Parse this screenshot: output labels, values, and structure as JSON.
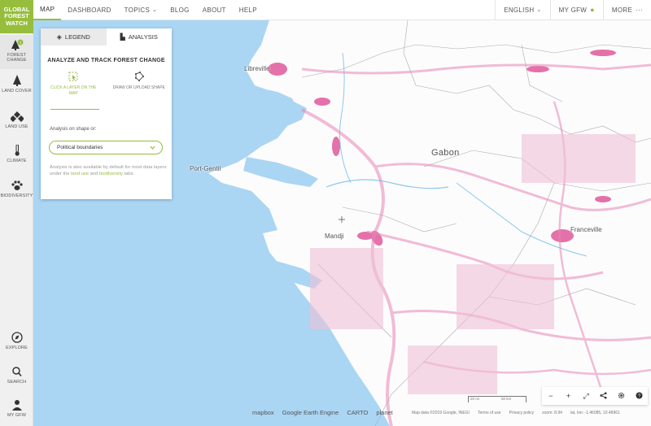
{
  "logo": {
    "line1": "GLOBAL",
    "line2": "FOREST",
    "line3": "WATCH"
  },
  "topnav": {
    "items": [
      "MAP",
      "DASHBOARD",
      "TOPICS",
      "BLOG",
      "ABOUT",
      "HELP"
    ],
    "language": "ENGLISH",
    "my_gfw": "MY GFW",
    "more": "MORE"
  },
  "sidebar": {
    "items": [
      {
        "label": "FOREST CHANGE",
        "icon": "forest-change-icon"
      },
      {
        "label": "LAND COVER",
        "icon": "land-cover-icon"
      },
      {
        "label": "LAND USE",
        "icon": "land-use-icon"
      },
      {
        "label": "CLIMATE",
        "icon": "climate-icon"
      },
      {
        "label": "BIODIVERSITY",
        "icon": "biodiversity-icon"
      },
      {
        "label": "EXPLORE",
        "icon": "explore-icon"
      },
      {
        "label": "SEARCH",
        "icon": "search-icon"
      },
      {
        "label": "MY GFW",
        "icon": "user-icon"
      }
    ],
    "badge": "1"
  },
  "panel": {
    "tabs": {
      "legend": "LEGEND",
      "analysis": "ANALYSIS"
    },
    "title": "ANALYZE AND TRACK FOREST CHANGE",
    "mode_click": "CLICK A LAYER ON THE MAP",
    "mode_draw": "DRAW OR UPLOAD SHAPE",
    "shape_label": "Analysis on shape or:",
    "select_value": "Political boundaries",
    "note_prefix": "Analysis is also available by default for most data layers under the",
    "note_link1": "land use",
    "note_and": "and",
    "note_link2": "biodiversity",
    "note_suffix": "tabs."
  },
  "map": {
    "country": "Gabon",
    "cities": [
      "Libreville",
      "Port-Gentil",
      "Mandji",
      "Franceville"
    ],
    "colors": {
      "ocean": "#aad6f4",
      "land": "#fdfcfd",
      "loss": "#e0589a",
      "accent": "#97bd3d"
    }
  },
  "attribution": {
    "brands": [
      "mapbox",
      "Google Earth Engine",
      "CARTO",
      "planet"
    ],
    "map_data": "Map data ©2019 Google, INEGI",
    "terms": "Terms of use",
    "privacy": "Privacy policy",
    "zoom": "zoom: 8.94",
    "latlon": "lat, lon: -1.46085, 10.48961"
  },
  "scale": {
    "a": "20 mi",
    "b": "50 km"
  },
  "controls": [
    "−",
    "+",
    "⤢",
    "share",
    "settings",
    "help"
  ]
}
